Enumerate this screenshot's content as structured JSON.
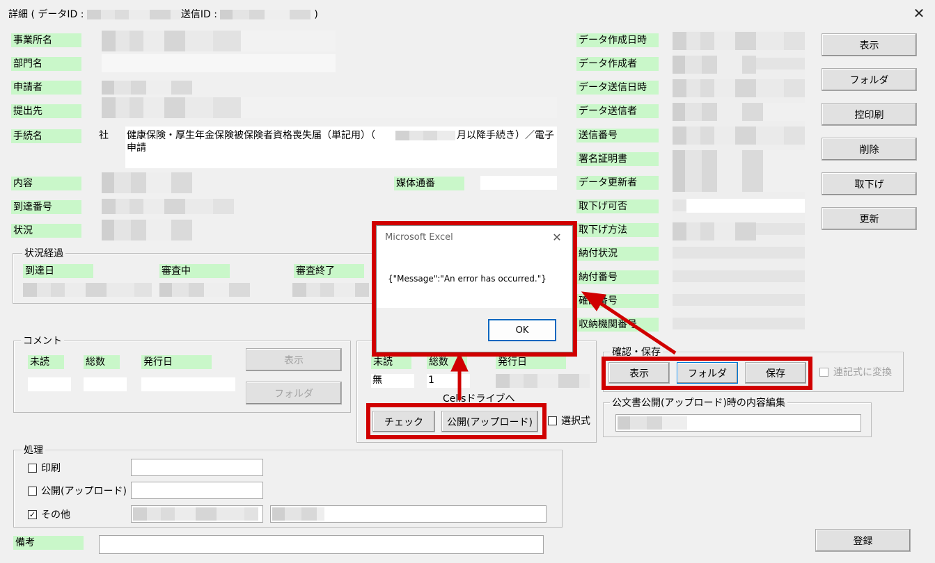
{
  "window": {
    "title_prefix": "詳細 ( データID : ",
    "title_mid": "送信ID : ",
    "title_suffix": ")",
    "close_glyph": "✕"
  },
  "fields_left": {
    "jigyosho": "事業所名",
    "bumon": "部門名",
    "shinseisha": "申請者",
    "teishutsusaki": "提出先",
    "tetsuzuki": "手続名",
    "tetsuzuki_prefix": "社",
    "tetsuzuki_value_a": "健康保険・厚生年金保険被保険者資格喪失届（単記用）（",
    "tetsuzuki_value_b": "月以降手続き）／電子",
    "tetsuzuki_value_c": "申請",
    "naiyo": "内容",
    "baitai": "媒体通番",
    "totatsu": "到達番号",
    "jokyo": "状況"
  },
  "fields_right": {
    "sakusei_nichiji": "データ作成日時",
    "sakuseisha": "データ作成者",
    "soshin_nichiji": "データ送信日時",
    "soshinsha": "データ送信者",
    "soshin_bango": "送信番号",
    "shomei": "署名証明書",
    "koshinsha": "データ更新者",
    "torisage_kahi": "取下げ可否",
    "torisage_hoho": "取下げ方法",
    "nofu_jokyo": "納付状況",
    "nofu_bango": "納付番号",
    "kakunin_bango": "確認番号",
    "shuno": "収納機関番号"
  },
  "side_buttons": [
    "表示",
    "フォルダ",
    "控印刷",
    "削除",
    "取下げ",
    "更新"
  ],
  "status_history": {
    "title": "状況経過",
    "cols": [
      "到達日",
      "審査中",
      "審査終了"
    ]
  },
  "comment": {
    "title": "コメント",
    "cols": [
      "未読",
      "総数",
      "発行日"
    ],
    "btn_show": "表示",
    "btn_folder": "フォルダ"
  },
  "kobunsho": {
    "cols": [
      "未読",
      "総数",
      "発行日"
    ],
    "unread_value": "無",
    "total_value": "1",
    "cells_label": "Cellsドライブへ",
    "btn_check": "チェック",
    "btn_publish": "公開(アップロード)",
    "select_label": "選択式"
  },
  "confirm_save": {
    "title": "確認・保存",
    "btn_show": "表示",
    "btn_folder": "フォルダ",
    "btn_save": "保存",
    "chk_label": "連記式に変換"
  },
  "publish_edit": {
    "title": "公文書公開(アップロード)時の内容編集"
  },
  "process": {
    "title": "処理",
    "print": "印刷",
    "publish": "公開(アップロード)",
    "other": "その他",
    "other_checked": "✓"
  },
  "biko": "備考",
  "btn_register": "登録",
  "dialog": {
    "title": "Microsoft Excel",
    "close_glyph": "✕",
    "message": "{\"Message\":\"An error has occurred.\"}",
    "ok": "OK"
  },
  "colors": {
    "label_bg": "#c9f7c9",
    "highlight": "#d00000",
    "window_bg": "#f0f0f0"
  }
}
